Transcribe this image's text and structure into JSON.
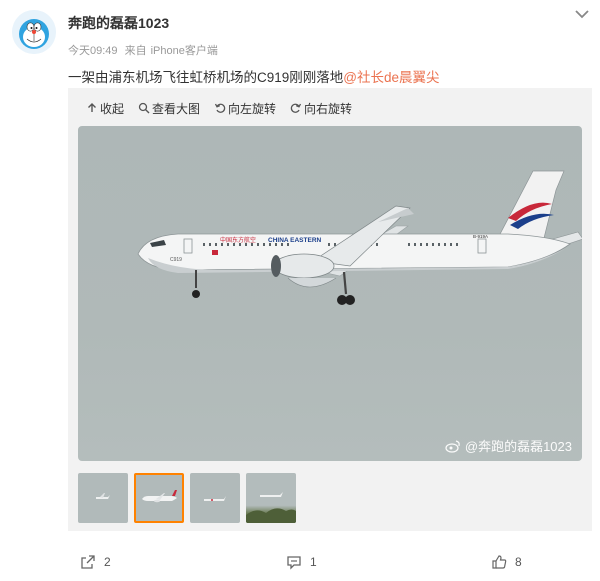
{
  "post": {
    "author": "奔跑的磊磊1023",
    "time": "今天09:49",
    "source_prefix": "来自",
    "source": "iPhone客户端",
    "text": "一架由浦东机场飞往虹桥机场的C919刚刚落地",
    "mention": "@社长de晨翼尖"
  },
  "toolbar": {
    "collapse": "收起",
    "view_large": "查看大图",
    "rotate_left": "向左旋转",
    "rotate_right": "向右旋转"
  },
  "image": {
    "watermark": "@奔跑的磊磊1023",
    "aircraft_reg": "B-919A",
    "livery_cn": "中国东方航空",
    "livery_en": "CHINA EASTERN",
    "model": "C919"
  },
  "thumbnails": {
    "count": 4,
    "active_index": 1
  },
  "footer": {
    "share_count": "2",
    "comment_count": "1",
    "like_count": "8"
  },
  "colors": {
    "mention": "#eb7350",
    "active_thumb_border": "#ff8200",
    "sky": "#b0b9b8",
    "tail_red": "#c8283a",
    "tail_blue": "#1b3f8b"
  }
}
